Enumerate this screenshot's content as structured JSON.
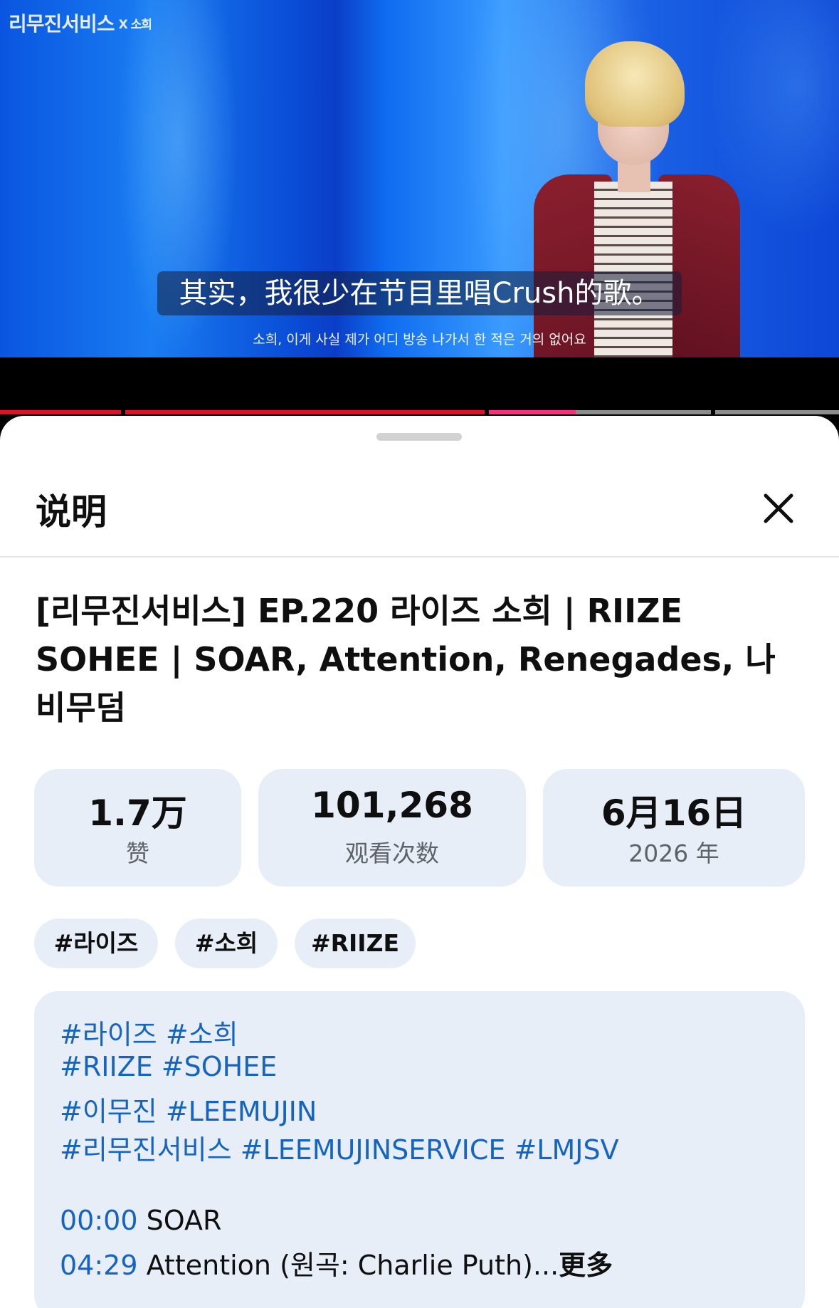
{
  "video": {
    "channel_logo": "리무진서비스",
    "collab_label": "X 소희",
    "subtitle_cn": "其实，我很少在节目里唱Crush的歌。",
    "subtitle_kr": "소희,   이게 사실 제가 어디 방송 나가서 한 적은 거의 없어요"
  },
  "progress_colors": {
    "played": "#e4102a",
    "ad": "#ff2d7d",
    "buffered": "#8c8c8c"
  },
  "sheet": {
    "title": "说明",
    "close_icon": "close-icon"
  },
  "video_title": "[리무진서비스] EP.220 라이즈 소희 | RIIZE SOHEE | SOAR, Attention, Renegades, 나비무덤",
  "stats": [
    {
      "value": "1.7万",
      "label": "赞"
    },
    {
      "value": "101,268",
      "label": "观看次数"
    },
    {
      "value": "6月16日",
      "label": "2026 年"
    }
  ],
  "tags": [
    "#라이즈",
    "#소희",
    "#RIIZE"
  ],
  "description": {
    "hashtag_lines": [
      [
        "#라이즈",
        "#소희"
      ],
      [
        "#RIIZE",
        "#SOHEE"
      ],
      [
        "#이무진",
        "#LEEMUJIN"
      ],
      [
        "#리무진서비스",
        "#LEEMUJINSERVICE",
        "#LMJSV"
      ]
    ],
    "chapters": [
      {
        "time": "00:00",
        "title": "SOAR"
      },
      {
        "time": "04:29",
        "title": "Attention (원곡: Charlie Puth)..."
      }
    ],
    "more_label": "更多"
  },
  "accent_colors": {
    "link": "#1565c0",
    "chip_bg": "#e8eef8"
  }
}
